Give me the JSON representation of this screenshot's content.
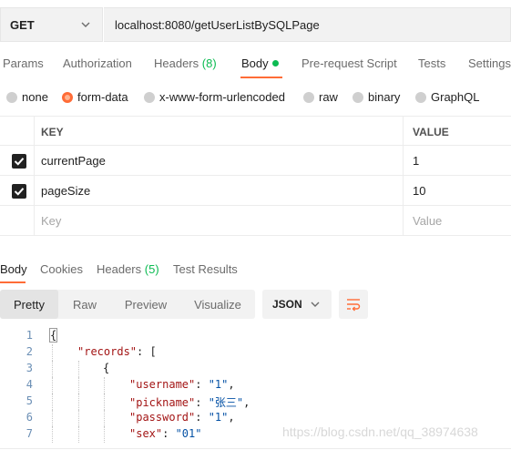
{
  "request": {
    "method": "GET",
    "url": "localhost:8080/getUserListBySQLPage"
  },
  "request_tabs": [
    {
      "label": "Params"
    },
    {
      "label": "Authorization"
    },
    {
      "label": "Headers",
      "count": "(8)"
    },
    {
      "label": "Body",
      "active": true
    },
    {
      "label": "Pre-request Script"
    },
    {
      "label": "Tests"
    },
    {
      "label": "Settings"
    }
  ],
  "body_types": [
    {
      "label": "none"
    },
    {
      "label": "form-data",
      "selected": true
    },
    {
      "label": "x-www-form-urlencoded"
    },
    {
      "label": "raw"
    },
    {
      "label": "binary"
    },
    {
      "label": "GraphQL"
    }
  ],
  "params_table": {
    "headers": {
      "key": "KEY",
      "value": "VALUE"
    },
    "rows": [
      {
        "key": "currentPage",
        "value": "1",
        "checked": true
      },
      {
        "key": "pageSize",
        "value": "10",
        "checked": true
      }
    ],
    "placeholder": {
      "key": "Key",
      "value": "Value"
    }
  },
  "response_tabs": [
    {
      "label": "Body",
      "active": true
    },
    {
      "label": "Cookies"
    },
    {
      "label": "Headers",
      "count": "(5)"
    },
    {
      "label": "Test Results"
    }
  ],
  "view_modes": [
    "Pretty",
    "Raw",
    "Preview",
    "Visualize"
  ],
  "active_view": "Pretty",
  "format": "JSON",
  "code_lines": [
    {
      "num": "1",
      "text": "{"
    },
    {
      "num": "2",
      "key": "\"records\"",
      "rest": ": ["
    },
    {
      "num": "3",
      "text": "{"
    },
    {
      "num": "4",
      "key": "\"username\"",
      "sep": ": ",
      "str": "\"1\"",
      "rest": ","
    },
    {
      "num": "5",
      "key": "\"pickname\"",
      "sep": ": ",
      "str": "\"张三\"",
      "rest": ","
    },
    {
      "num": "6",
      "key": "\"password\"",
      "sep": ": ",
      "str": "\"1\"",
      "rest": ","
    },
    {
      "num": "7",
      "key": "\"sex\"",
      "sep": ": ",
      "str": "\"01\"",
      "rest": ""
    }
  ],
  "watermark": "https://blog.csdn.net/qq_38974638",
  "colors": {
    "accent": "#ff6c37",
    "green": "#0cbb52"
  }
}
